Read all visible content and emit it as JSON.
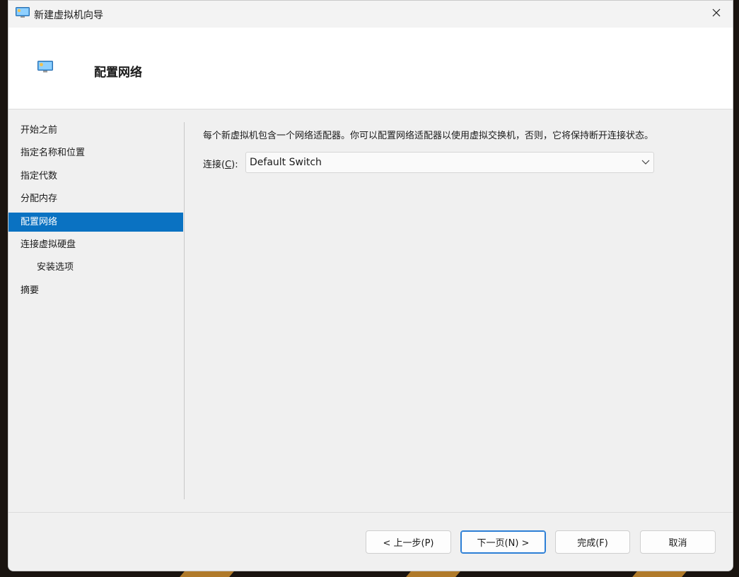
{
  "window": {
    "title": "新建虚拟机向导",
    "header_title": "配置网络"
  },
  "nav": {
    "items": [
      {
        "label": "开始之前"
      },
      {
        "label": "指定名称和位置"
      },
      {
        "label": "指定代数"
      },
      {
        "label": "分配内存"
      },
      {
        "label": "配置网络"
      },
      {
        "label": "连接虚拟硬盘"
      },
      {
        "label": "安装选项"
      },
      {
        "label": "摘要"
      }
    ],
    "active": "配置网络"
  },
  "content": {
    "description": "每个新虚拟机包含一个网络适配器。你可以配置网络适配器以使用虚拟交换机，否则，它将保持断开连接状态。",
    "connection_label_prefix": "连接(",
    "connection_label_key": "C",
    "connection_label_suffix": "):",
    "connection_value": "Default Switch"
  },
  "buttons": {
    "prev": "< 上一步(P)",
    "next": "下一页(N) >",
    "finish": "完成(F)",
    "cancel": "取消"
  },
  "colors": {
    "accent": "#0a72c2",
    "primary_border": "#2c7fd6"
  },
  "icons": {
    "app": "vm-monitor-icon",
    "close": "close-icon",
    "dropdown": "chevron-down-icon"
  }
}
